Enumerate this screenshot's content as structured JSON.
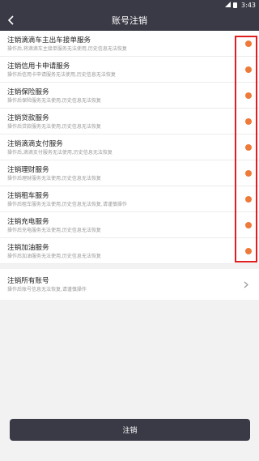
{
  "statusbar": {
    "time": "3:43"
  },
  "navbar": {
    "title": "账号注销"
  },
  "services": [
    {
      "title": "注销滴滴车主出车接单服务",
      "desc": "操作后,将滴滴车主接单服务无法使用,历史信息无法恢复"
    },
    {
      "title": "注销信用卡申请服务",
      "desc": "操作后信用卡申请服务无法使用,历史信息无法恢复"
    },
    {
      "title": "注销保险服务",
      "desc": "操作后保险服务无法使用,历史信息无法恢复"
    },
    {
      "title": "注销贷款服务",
      "desc": "操作后贷款服务无法使用,历史信息无法恢复"
    },
    {
      "title": "注销滴滴支付服务",
      "desc": "操作后,滴滴支付服务无法使用,历史信息无法恢复"
    },
    {
      "title": "注销理财服务",
      "desc": "操作后理财服务无法使用,历史信息无法恢复"
    },
    {
      "title": "注销租车服务",
      "desc": "操作后租车服务无法使用,历史信息无法恢复,请谨慎操作"
    },
    {
      "title": "注销充电服务",
      "desc": "操作后充电服务无法使用,历史信息无法恢复"
    },
    {
      "title": "注销加油服务",
      "desc": "操作后加油服务无法使用,历史信息无法恢复"
    }
  ],
  "all_accounts": {
    "title": "注销所有账号",
    "desc": "操作后账号信息无法恢复,请谨慎操作"
  },
  "submit": {
    "label": "注销"
  },
  "colors": {
    "bar": "#3a3a46",
    "radio": "#ee7a3a",
    "highlight": "#e02020"
  }
}
